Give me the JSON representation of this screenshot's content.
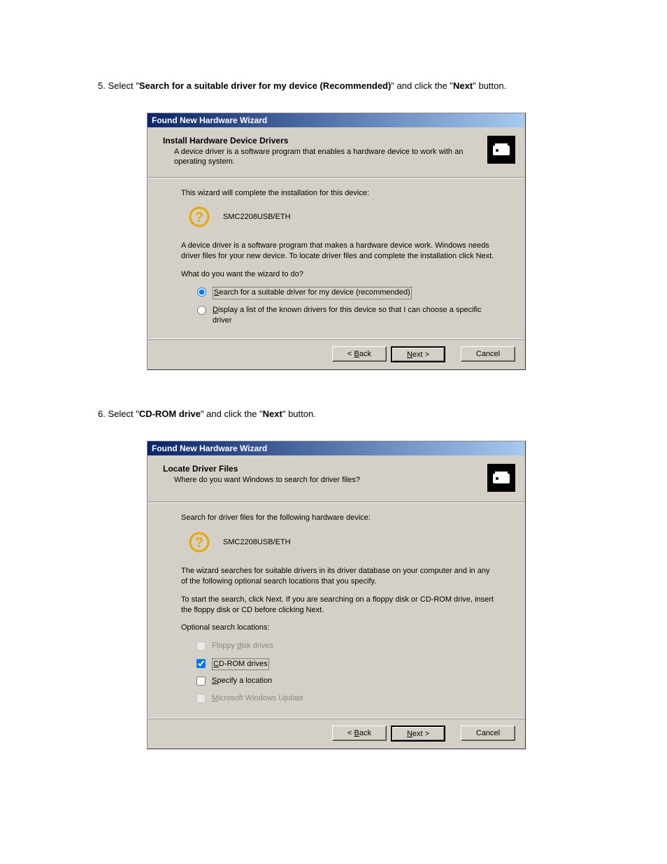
{
  "step5": {
    "prefix": "5. Select \"",
    "bold1": "Search for a suitable driver for my device (Recommended)",
    "mid": "\" and click the \"",
    "bold2": "Next",
    "suffix": "\" button."
  },
  "step6": {
    "prefix": "6. Select \"",
    "bold1": "CD-ROM drive",
    "mid": "\" and click the \"",
    "bold2": "Next",
    "suffix": "\" button."
  },
  "dialog1": {
    "title": "Found New Hardware Wizard",
    "header_title": "Install Hardware Device Drivers",
    "header_sub": "A device driver is a software program that enables a hardware device to work with an operating system.",
    "intro": "This wizard will complete the installation for this device:",
    "device": "SMC2208USB/ETH",
    "explain": "A device driver is a software program that makes a hardware device work. Windows needs driver files for your new device. To locate driver files and complete the installation click Next.",
    "question": "What do you want the wizard to do?",
    "radio1": "Search for a suitable driver for my device (recommended)",
    "radio2": "Display a list of the known drivers for this device so that I can choose a specific driver",
    "back": "< Back",
    "next": "Next >",
    "cancel": "Cancel"
  },
  "dialog2": {
    "title": "Found New Hardware Wizard",
    "header_title": "Locate Driver Files",
    "header_sub": "Where do you want Windows to search for driver files?",
    "intro": "Search for driver files for the following hardware device:",
    "device": "SMC2208USB/ETH",
    "explain1": "The wizard searches for suitable drivers in its driver database on your computer and in any of the following optional search locations that you specify.",
    "explain2": "To start the search, click Next. If you are searching on a floppy disk or CD-ROM drive, insert the floppy disk or CD before clicking Next.",
    "opt_label": "Optional search locations:",
    "chk1": "Floppy disk drives",
    "chk2": "CD-ROM drives",
    "chk3": "Specify a location",
    "chk4": "Microsoft Windows Update",
    "back": "< Back",
    "next": "Next >",
    "cancel": "Cancel"
  }
}
